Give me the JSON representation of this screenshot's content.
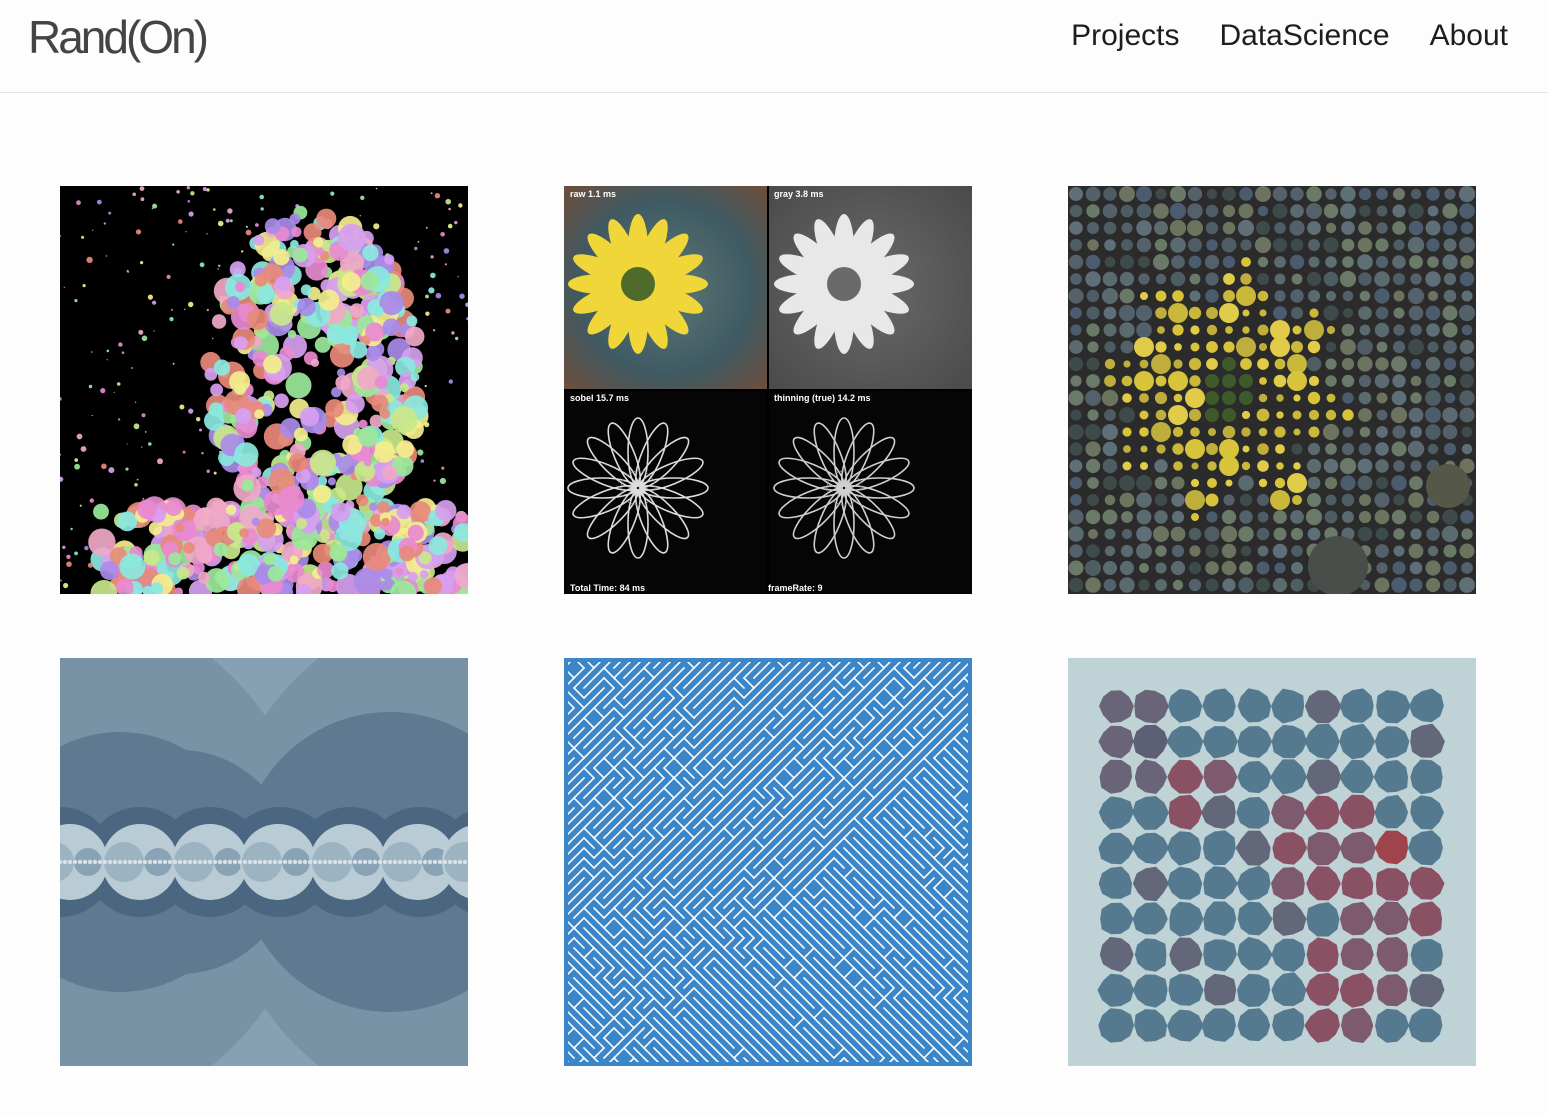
{
  "brand": {
    "title": "Rand(On)"
  },
  "nav": {
    "items": [
      {
        "label": "Projects"
      },
      {
        "label": "DataScience"
      },
      {
        "label": "About"
      }
    ]
  },
  "gallery": {
    "tiles": [
      {
        "id": "portrait-circles"
      },
      {
        "id": "flower-edge-detection",
        "labels": {
          "raw": "raw 1.1 ms",
          "gray": "gray 3.8 ms",
          "sobel": "sobel 15.7 ms",
          "thinning": "thinning (true) 14.2 ms",
          "total": "Total Time: 84 ms",
          "framerate": "frameRate: 9"
        }
      },
      {
        "id": "flower-circle-packing"
      },
      {
        "id": "nested-circles"
      },
      {
        "id": "blue-maze"
      },
      {
        "id": "blob-grid"
      }
    ]
  },
  "colors": {
    "maze_blue": "#3a86c8",
    "circles_bg": "#6f8da3",
    "blob_bg": "#bfd3d7",
    "blob_blue": "#587d92",
    "blob_red": "#a04a55"
  }
}
